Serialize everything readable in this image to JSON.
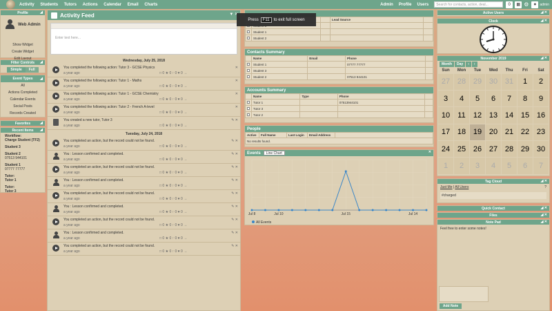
{
  "nav": {
    "items": [
      "Activity",
      "Students",
      "Tutors",
      "Actions",
      "Calendar",
      "Email",
      "Charts"
    ],
    "right_items": [
      "Admin",
      "Profile",
      "Users"
    ],
    "search_placeholder": "Search for contacts, action, deal...",
    "notifications_count": "0",
    "username": "admin"
  },
  "profile": {
    "title": "Profile",
    "name": "Web Admin",
    "links": [
      "Show Widget",
      "Create Widget",
      "Edit Layout"
    ]
  },
  "filter": {
    "title": "Filter Controls",
    "simple": "Simple",
    "full": "Full"
  },
  "event_types": {
    "title": "Event Types",
    "items": [
      "All",
      "Actions Completed",
      "Calendar Events",
      "Social Posts",
      "Records Created"
    ]
  },
  "favorites": {
    "title": "Favorites"
  },
  "recent": {
    "title": "Recent Items",
    "items": [
      {
        "label": "Workflow:",
        "value": "Charge Student (TF2)"
      },
      {
        "label": "Student 3",
        "value": ""
      },
      {
        "label": "Student 2",
        "value": "07513 944101"
      },
      {
        "label": "Student 1",
        "value": "07777 77777"
      },
      {
        "label": "Tutor:",
        "value": "Tutor 1"
      },
      {
        "label": "Tutor:",
        "value": "Tutor 3"
      }
    ]
  },
  "feed": {
    "title": "Activity Feed",
    "placeholder": "Enter text here...",
    "day1": "Wednesday, July 25, 2018",
    "day2": "Tuesday, July 24, 2018",
    "entries_day1": [
      {
        "text": "You completed the following action: Tutor 3 - GCSE Physics",
        "ago": "a year ago",
        "icon": "play"
      },
      {
        "text": "You completed the following action: Tutor 1 - Maths",
        "ago": "a year ago",
        "icon": "play"
      },
      {
        "text": "You completed the following action: Tutor 1 - GCSE Chemistry",
        "ago": "a year ago",
        "icon": "play"
      },
      {
        "text": "You completed the following action: Tutor 2 - French A-level",
        "ago": "a year ago",
        "icon": "play"
      },
      {
        "text": "You created a new tutor, Tutor 3",
        "ago": "a year ago",
        "icon": "doc"
      }
    ],
    "entries_day2": [
      {
        "text": "You completed an action, but the record could not be found.",
        "ago": "a year ago",
        "icon": "play"
      },
      {
        "text": "You : Lesson confirmed and completed.",
        "ago": "a year ago",
        "icon": "user"
      },
      {
        "text": "You completed an action, but the record could not be found.",
        "ago": "a year ago",
        "icon": "play"
      },
      {
        "text": "You : Lesson confirmed and completed.",
        "ago": "a year ago",
        "icon": "user"
      },
      {
        "text": "You completed an action, but the record could not be found.",
        "ago": "a year ago",
        "icon": "play"
      },
      {
        "text": "You : Lesson confirmed and completed.",
        "ago": "a year ago",
        "icon": "user"
      },
      {
        "text": "You completed an action, but the record could not be found.",
        "ago": "a year ago",
        "icon": "play"
      },
      {
        "text": "You : Lesson confirmed and completed.",
        "ago": "a year ago",
        "icon": "user"
      },
      {
        "text": "You completed an action, but the record could not be found.",
        "ago": "a year ago",
        "icon": "play"
      }
    ],
    "action_counts": "□ 0  ★ 0  ↑ 0  ♥ 0  →"
  },
  "toast": {
    "pre": "Press",
    "key": "F11",
    "post": "to exit full screen"
  },
  "students_table": {
    "lead_source_header": "Lead Source",
    "rows": [
      "Student 3",
      "Student 1",
      "Student 2"
    ]
  },
  "contacts": {
    "title": "Contacts Summary",
    "headers": [
      "Name",
      "Email",
      "Phone"
    ],
    "rows": [
      {
        "name": "Student 1",
        "email": "",
        "phone": "07777 77777"
      },
      {
        "name": "Student 3",
        "email": "",
        "phone": ""
      },
      {
        "name": "Student 2",
        "email": "",
        "phone": "07513 944101"
      }
    ]
  },
  "accounts": {
    "title": "Accounts Summary",
    "headers": [
      "Name",
      "Type",
      "Phone"
    ],
    "rows": [
      {
        "name": "Tutor 1",
        "type": "",
        "phone": "07513944101"
      },
      {
        "name": "Tutor 3",
        "type": "",
        "phone": ""
      },
      {
        "name": "Tutor 2",
        "type": "",
        "phone": ""
      }
    ]
  },
  "people": {
    "title": "People",
    "headers": [
      "Active",
      "Full Name",
      "Last Login",
      "Email Address"
    ],
    "empty": "No results found."
  },
  "events": {
    "title": "Events",
    "chart_type_option": "Line Chart"
  },
  "chart_data": {
    "type": "line",
    "x": [
      "Jul 8",
      "",
      "Jul 10",
      "",
      "",
      "",
      "",
      "Jul 15",
      "",
      "",
      "",
      "",
      "Jul 14",
      ""
    ],
    "tick_labels": [
      "Jul 8",
      "Jul 10",
      "Jul 15",
      "Jul 14"
    ],
    "series": [
      {
        "name": "All Events",
        "values": [
          0,
          0,
          0,
          0,
          0,
          0,
          0,
          1,
          0,
          0,
          0,
          0,
          0,
          0
        ]
      }
    ],
    "ylim": [
      0,
      1.3
    ],
    "color": "#3a86c8"
  },
  "active_users": {
    "title": "Active Users"
  },
  "clock": {
    "title": "Clock",
    "time": "10:07"
  },
  "calendar": {
    "title": "November 2019",
    "month_btn": "Month",
    "day_btn": "Day",
    "weekdays": [
      "Sun",
      "Mon",
      "Tue",
      "Wed",
      "Thu",
      "Fri",
      "Sat"
    ],
    "weeks": [
      [
        [
          "27",
          1
        ],
        [
          "28",
          1
        ],
        [
          "29",
          1
        ],
        [
          "30",
          1
        ],
        [
          "31",
          1
        ],
        [
          "1",
          0
        ],
        [
          "2",
          0
        ]
      ],
      [
        [
          "3",
          0
        ],
        [
          "4",
          0
        ],
        [
          "5",
          0
        ],
        [
          "6",
          0
        ],
        [
          "7",
          0
        ],
        [
          "8",
          0
        ],
        [
          "9",
          0
        ]
      ],
      [
        [
          "10",
          0
        ],
        [
          "11",
          0
        ],
        [
          "12",
          0
        ],
        [
          "13",
          0
        ],
        [
          "14",
          0
        ],
        [
          "15",
          0
        ],
        [
          "16",
          0
        ]
      ],
      [
        [
          "17",
          0
        ],
        [
          "18",
          0
        ],
        [
          "19",
          2
        ],
        [
          "20",
          0
        ],
        [
          "21",
          0
        ],
        [
          "22",
          0
        ],
        [
          "23",
          0
        ]
      ],
      [
        [
          "24",
          0
        ],
        [
          "25",
          0
        ],
        [
          "26",
          0
        ],
        [
          "27",
          0
        ],
        [
          "28",
          0
        ],
        [
          "29",
          0
        ],
        [
          "30",
          0
        ]
      ],
      [
        [
          "1",
          1
        ],
        [
          "2",
          1
        ],
        [
          "3",
          1
        ],
        [
          "4",
          1
        ],
        [
          "5",
          1
        ],
        [
          "6",
          1
        ],
        [
          "7",
          1
        ]
      ]
    ]
  },
  "tag_cloud": {
    "title": "Tag Cloud",
    "just_me": "Just Me",
    "all_users": "All Users",
    "tag": "#charged"
  },
  "quick_contact": {
    "title": "Quick Contact"
  },
  "files": {
    "title": "Files"
  },
  "note_pad": {
    "title": "Note Pad",
    "placeholder": "Feel free to enter some notes!",
    "button": "Add Note"
  }
}
